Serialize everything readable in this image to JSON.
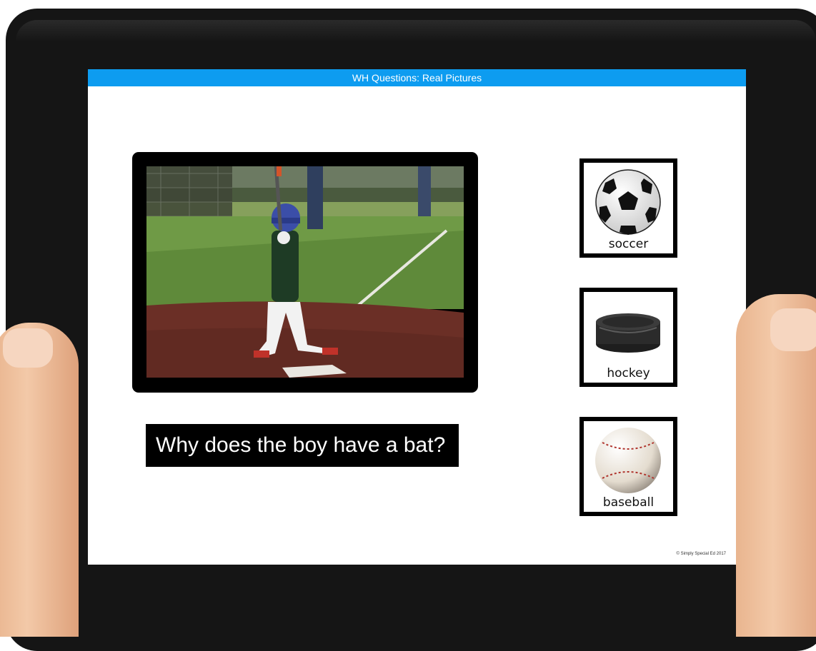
{
  "app": {
    "title": "WH Questions: Real Pictures",
    "accent_color": "#0d9cf0"
  },
  "photo": {
    "subject": "boy-batting-baseball"
  },
  "question": {
    "text": "Why does the boy have a bat?"
  },
  "choices": [
    {
      "label": "soccer",
      "icon": "soccer-ball-icon"
    },
    {
      "label": "hockey",
      "icon": "hockey-puck-icon"
    },
    {
      "label": "baseball",
      "icon": "baseball-icon"
    }
  ],
  "footer": {
    "copyright": "© Simply Special Ed 2017"
  }
}
